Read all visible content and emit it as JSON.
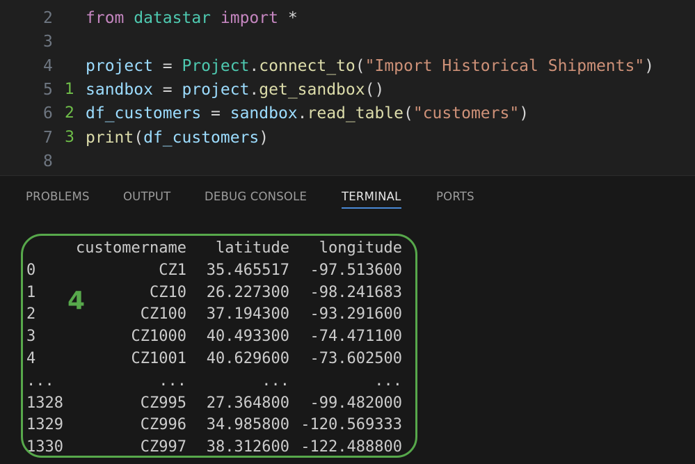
{
  "editor": {
    "lines": [
      {
        "number": "2",
        "marker": "",
        "tokens": [
          {
            "t": "from",
            "c": "keyword"
          },
          {
            "t": " datastar ",
            "c": "class"
          },
          {
            "t": "import",
            "c": "keyword"
          },
          {
            "t": " *",
            "c": "plain"
          }
        ]
      },
      {
        "number": "3",
        "marker": "",
        "tokens": []
      },
      {
        "number": "4",
        "marker": "",
        "tokens": [
          {
            "t": "project",
            "c": "var"
          },
          {
            "t": " = ",
            "c": "plain"
          },
          {
            "t": "Project",
            "c": "class"
          },
          {
            "t": ".",
            "c": "plain"
          },
          {
            "t": "connect_to",
            "c": "func"
          },
          {
            "t": "(",
            "c": "plain"
          },
          {
            "t": "\"Import Historical Shipments\"",
            "c": "string"
          },
          {
            "t": ")",
            "c": "plain"
          }
        ]
      },
      {
        "number": "5",
        "marker": "1",
        "tokens": [
          {
            "t": "sandbox",
            "c": "var"
          },
          {
            "t": " = ",
            "c": "plain"
          },
          {
            "t": "project",
            "c": "var"
          },
          {
            "t": ".",
            "c": "plain"
          },
          {
            "t": "get_sandbox",
            "c": "func"
          },
          {
            "t": "()",
            "c": "plain"
          }
        ]
      },
      {
        "number": "6",
        "marker": "2",
        "tokens": [
          {
            "t": "df_customers",
            "c": "var"
          },
          {
            "t": " = ",
            "c": "plain"
          },
          {
            "t": "sandbox",
            "c": "var"
          },
          {
            "t": ".",
            "c": "plain"
          },
          {
            "t": "read_table",
            "c": "func"
          },
          {
            "t": "(",
            "c": "plain"
          },
          {
            "t": "\"customers\"",
            "c": "string"
          },
          {
            "t": ")",
            "c": "plain"
          }
        ]
      },
      {
        "number": "7",
        "marker": "3",
        "tokens": [
          {
            "t": "print",
            "c": "func"
          },
          {
            "t": "(",
            "c": "plain"
          },
          {
            "t": "df_customers",
            "c": "var"
          },
          {
            "t": ")",
            "c": "plain"
          }
        ]
      },
      {
        "number": "8",
        "marker": "",
        "tokens": []
      }
    ]
  },
  "panel": {
    "tabs": [
      {
        "label": "PROBLEMS",
        "active": false
      },
      {
        "label": "OUTPUT",
        "active": false
      },
      {
        "label": "DEBUG CONSOLE",
        "active": false
      },
      {
        "label": "TERMINAL",
        "active": true
      },
      {
        "label": "PORTS",
        "active": false
      }
    ]
  },
  "terminal": {
    "header": {
      "index": "",
      "customername": "customername",
      "latitude": "latitude",
      "longitude": "longitude"
    },
    "rows": [
      {
        "index": "0",
        "customername": "CZ1",
        "latitude": "35.465517",
        "longitude": "-97.513600"
      },
      {
        "index": "1",
        "customername": "CZ10",
        "latitude": "26.227300",
        "longitude": "-98.241683"
      },
      {
        "index": "2",
        "customername": "CZ100",
        "latitude": "37.194300",
        "longitude": "-93.291600"
      },
      {
        "index": "3",
        "customername": "CZ1000",
        "latitude": "40.493300",
        "longitude": "-74.471100"
      },
      {
        "index": "4",
        "customername": "CZ1001",
        "latitude": "40.629600",
        "longitude": "-73.602500"
      },
      {
        "index": "...",
        "customername": "...",
        "latitude": "...",
        "longitude": "..."
      },
      {
        "index": "1328",
        "customername": "CZ995",
        "latitude": "27.364800",
        "longitude": "-99.482000"
      },
      {
        "index": "1329",
        "customername": "CZ996",
        "latitude": "34.985800",
        "longitude": "-120.569333"
      },
      {
        "index": "1330",
        "customername": "CZ997",
        "latitude": "38.312600",
        "longitude": "-122.488800"
      }
    ],
    "annotation_label": "4"
  },
  "colors": {
    "annotation_green": "#57a84b",
    "active_tab_underline": "#4a8ad6",
    "editor_background": "#1f1f1f",
    "panel_background": "#181818"
  }
}
